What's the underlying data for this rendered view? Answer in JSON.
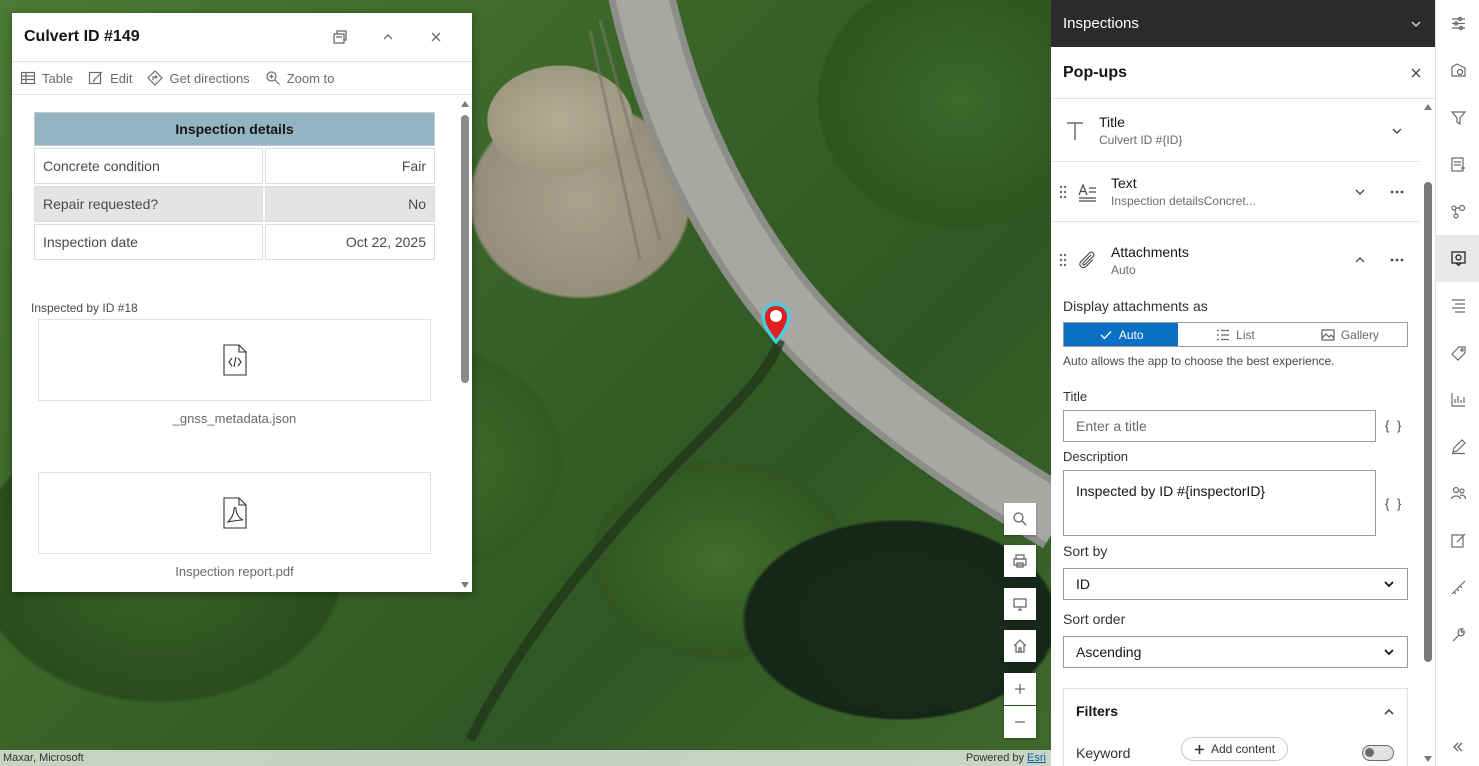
{
  "map": {
    "attribution_left": "Maxar, Microsoft",
    "attribution_powered": "Powered by",
    "attribution_esri": "Esri"
  },
  "popup": {
    "title": "Culvert ID #149",
    "actions": [
      "Table",
      "Edit",
      "Get directions",
      "Zoom to"
    ],
    "table_header": "Inspection details",
    "rows": [
      {
        "label": "Concrete condition",
        "value": "Fair"
      },
      {
        "label": "Repair requested?",
        "value": "No"
      },
      {
        "label": "Inspection date",
        "value": "Oct 22, 2025"
      }
    ],
    "inspected_by": "Inspected by ID #18",
    "attachments": [
      {
        "name": "_gnss_metadata.json",
        "icon": "code-file-icon"
      },
      {
        "name": "Inspection report.pdf",
        "icon": "pdf-file-icon"
      }
    ]
  },
  "panel": {
    "top_title": "Inspections",
    "header": "Pop-ups",
    "elements": {
      "title": {
        "name": "Title",
        "sub": "Culvert ID #{ID}"
      },
      "text": {
        "name": "Text",
        "sub": "Inspection detailsConcret..."
      },
      "attachments": {
        "name": "Attachments",
        "sub": "Auto"
      }
    },
    "display_as_label": "Display attachments as",
    "display_options": [
      "Auto",
      "List",
      "Gallery"
    ],
    "display_hint": "Auto allows the app to choose the best experience.",
    "title_label": "Title",
    "title_placeholder": "Enter a title",
    "description_label": "Description",
    "description_value": "Inspected by ID #{inspectorID}",
    "expression_glyph": "{ }",
    "sort_by_label": "Sort by",
    "sort_by_value": "ID",
    "sort_order_label": "Sort order",
    "sort_order_value": "Ascending",
    "filters_title": "Filters",
    "keyword_label": "Keyword",
    "add_content_label": "Add content"
  },
  "colors": {
    "accent": "#0b6fc4",
    "table_header": "#93b5c2",
    "marker_red": "#e0201f",
    "marker_halo": "#3fd2e6",
    "topbar": "#2b2b2b"
  }
}
